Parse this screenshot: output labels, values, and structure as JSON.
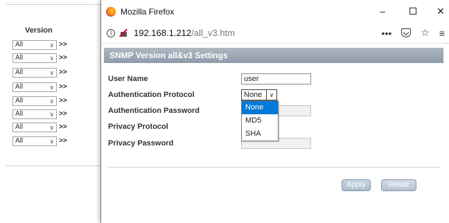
{
  "background_page": {
    "version_header": "Version",
    "rows": [
      {
        "value": "All",
        "arrow": ">>"
      },
      {
        "value": "All",
        "arrow": ">>"
      },
      {
        "value": "All",
        "arrow": ">>"
      },
      {
        "value": "All",
        "arrow": ">>"
      },
      {
        "value": "All",
        "arrow": ">>"
      },
      {
        "value": "All",
        "arrow": ">>"
      },
      {
        "value": "All",
        "arrow": ">>"
      },
      {
        "value": "All",
        "arrow": ">>"
      }
    ]
  },
  "window": {
    "title": "Mozilla Firefox",
    "controls": {
      "minimize": "–",
      "close": "✕"
    }
  },
  "urlbar": {
    "host": "192.168.1.212",
    "path": "/all_v3.htm",
    "info_glyph": "i",
    "more_glyph": "•••",
    "star_glyph": "☆",
    "menu_glyph": "≡"
  },
  "page": {
    "header": "SNMP Version all&v3 Settings",
    "fields": {
      "user_name_label": "User Name",
      "user_name_value": "user",
      "auth_protocol_label": "Authentication Protocol",
      "auth_protocol_value": "None",
      "auth_password_label": "Authentication Password",
      "privacy_protocol_label": "Privacy Protocol",
      "privacy_password_label": "Privacy Password"
    },
    "dropdown_options": [
      "None",
      "MD5",
      "SHA"
    ],
    "selected_option": "None",
    "buttons": {
      "apply": "Apply",
      "reset": "Reset"
    }
  },
  "colors": {
    "header_bg": "#9aa5b3",
    "selected_option_bg": "#0078d7",
    "insecure_slash": "#d70022"
  },
  "icons": {
    "logo": "firefox-logo-icon",
    "info": "info-icon",
    "insecure": "insecure-lock-icon",
    "more": "more-actions-icon",
    "pocket": "pocket-icon",
    "bookmark": "bookmark-star-icon",
    "menu": "hamburger-menu-icon"
  }
}
